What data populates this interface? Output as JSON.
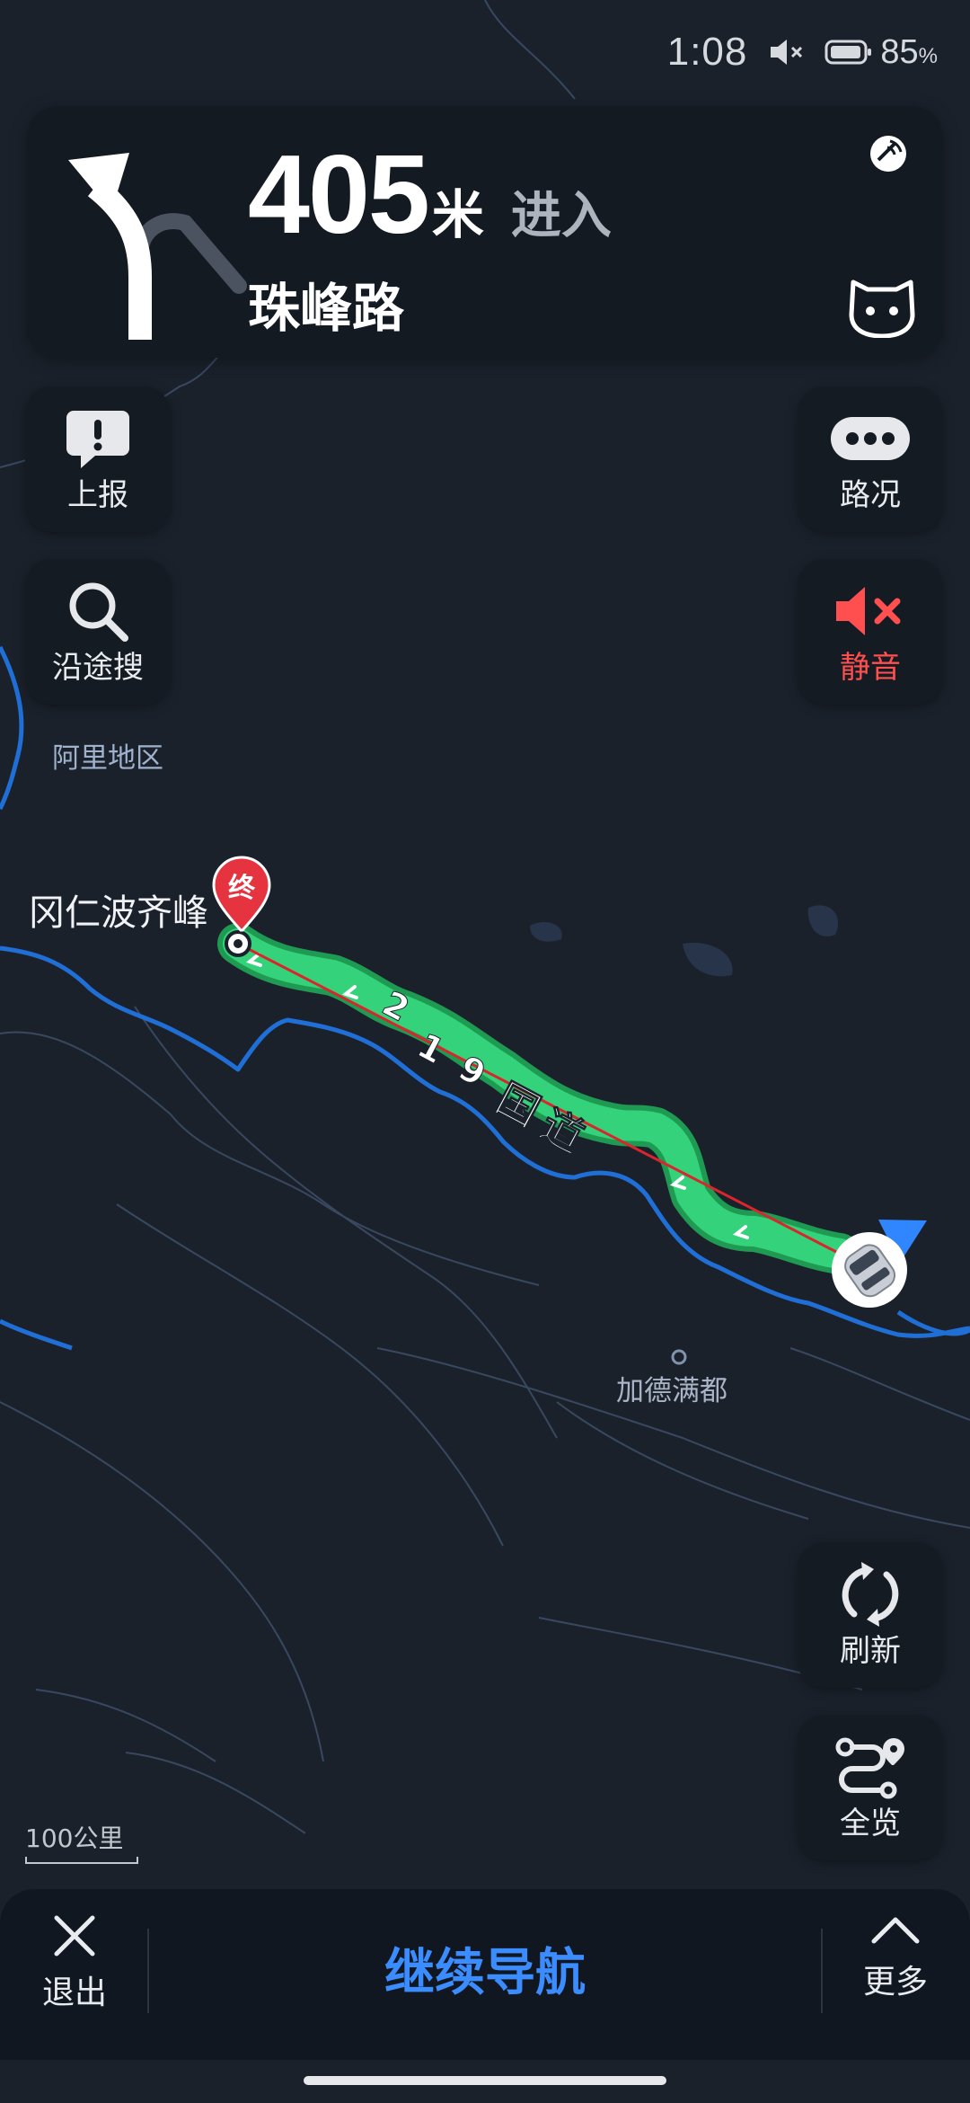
{
  "status_bar": {
    "time": "1:08",
    "battery_pct": "85",
    "battery_unit": "%",
    "icons": [
      "mute-icon",
      "battery-icon"
    ]
  },
  "guidance": {
    "distance": "405",
    "unit": "米",
    "action": "进入",
    "road": "珠峰路",
    "turn": "turn-left-arrow-icon"
  },
  "left_buttons": [
    {
      "label": "上报",
      "icon": "report-icon"
    },
    {
      "label": "沿途搜",
      "icon": "search-icon"
    }
  ],
  "right_buttons": [
    {
      "label": "路况",
      "icon": "traffic-icon"
    },
    {
      "label": "静音",
      "icon": "speaker-muted-icon"
    },
    {
      "label": "刷新",
      "icon": "refresh-icon"
    },
    {
      "label": "全览",
      "icon": "route-overview-icon"
    }
  ],
  "map": {
    "labels": {
      "region": "阿里地区",
      "peak": "冈仁波齐峰",
      "town": "加德满都"
    },
    "route_name_chars": [
      "2",
      "1",
      "9",
      "国",
      "道"
    ],
    "destination_marker": "终",
    "scale": "100公里",
    "colors": {
      "route": "#34d27a",
      "route_edge": "#1e9a52",
      "border": "#1f6fd6",
      "guide_line": "#d9262c",
      "dest": "#e53340"
    }
  },
  "bottom_bar": {
    "exit": "退出",
    "continue": "继续导航",
    "more": "更多"
  },
  "accent": "#3b8cff"
}
